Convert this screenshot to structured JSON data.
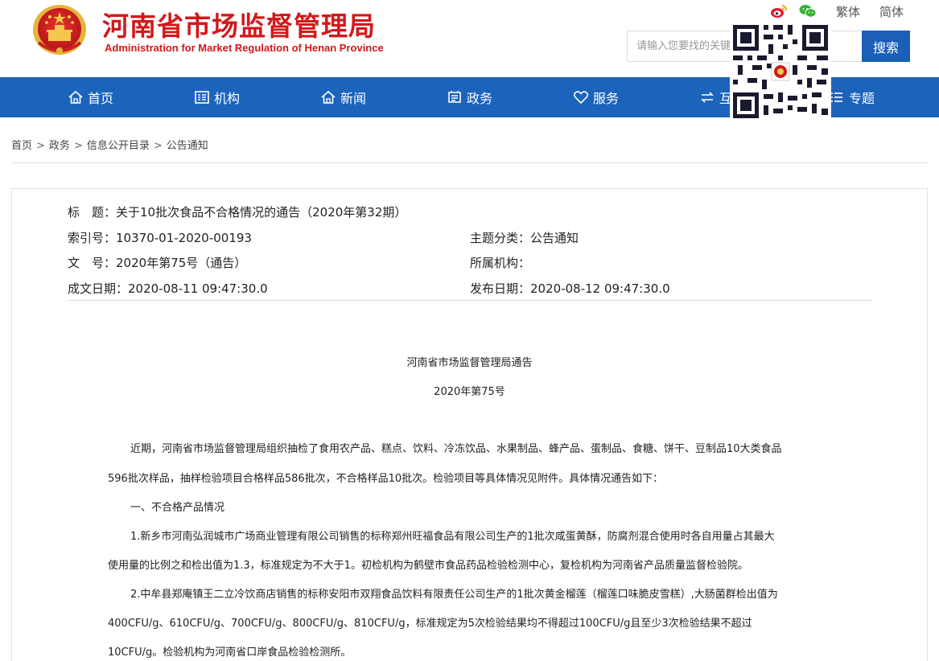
{
  "header": {
    "logo_cn": "河南省市场监督管理局",
    "logo_en": "Administration for Market Regulation of Henan Province",
    "lang_traditional": "繁体",
    "lang_simplified": "简体",
    "search_placeholder": "请输入您要找的关键",
    "search_button": "搜索",
    "brand_color": "#d3181b",
    "nav_color": "#1c64bb"
  },
  "nav": {
    "items": [
      {
        "label": "首页",
        "icon": "home-icon"
      },
      {
        "label": "机构",
        "icon": "org-icon"
      },
      {
        "label": "新闻",
        "icon": "news-icon"
      },
      {
        "label": "政务",
        "icon": "gov-icon"
      },
      {
        "label": "服务",
        "icon": "heart-icon"
      },
      {
        "label": "互",
        "icon": "exchange-icon"
      },
      {
        "label": "专题",
        "icon": "list-icon"
      }
    ]
  },
  "breadcrumb": [
    "首页",
    "政务",
    "信息公开目录",
    "公告通知"
  ],
  "meta": {
    "title_label": "标　题：",
    "title_value": "关于10批次食品不合格情况的通告（2020年第32期）",
    "index_label": "索引号：",
    "index_value": "10370-01-2020-00193",
    "topic_label": "主题分类：",
    "topic_value": "公告通知",
    "doc_label": "文　号：",
    "doc_value": "2020年第75号（通告）",
    "org_label": "所属机构：",
    "org_value": "",
    "created_label": "成文日期：",
    "created_value": "2020-08-11 09:47:30.0",
    "published_label": "发布日期：",
    "published_value": "2020-08-12 09:47:30.0"
  },
  "article": {
    "heading": "河南省市场监督管理局通告",
    "number": "2020年第75号",
    "lines": [
      "近期，河南省市场监督管理局组织抽检了食用农产品、糕点、饮料、冷冻饮品、水果制品、蜂产品、蛋制品、食糖、饼干、豆制品10大类食品",
      "596批次样品，抽样检验项目合格样品586批次，不合格样品10批次。检验项目等具体情况见附件。具体情况通告如下：",
      "一、不合格产品情况",
      "1.新乡市河南弘润城市广场商业管理有限公司销售的标称郑州旺福食品有限公司生产的1批次咸蛋黄酥，防腐剂混合使用时各自用量占其最大",
      "使用量的比例之和检出值为1.3，标准规定为不大于1。初检机构为鹤壁市食品药品检验检测中心，复检机构为河南省产品质量监督检验院。",
      "2.中牟县郑庵镇王二立冷饮商店销售的标称安阳市双翔食品饮料有限责任公司生产的1批次黄金榴莲（榴莲口味脆皮雪糕）,大肠菌群检出值为",
      "400CFU/g、610CFU/g、700CFU/g、800CFU/g、810CFU/g，标准规定为5次检验结果均不得超过100CFU/g且至少3次检验结果不超过",
      "10CFU/g。检验机构为河南省口岸食品检验检测所。"
    ]
  }
}
